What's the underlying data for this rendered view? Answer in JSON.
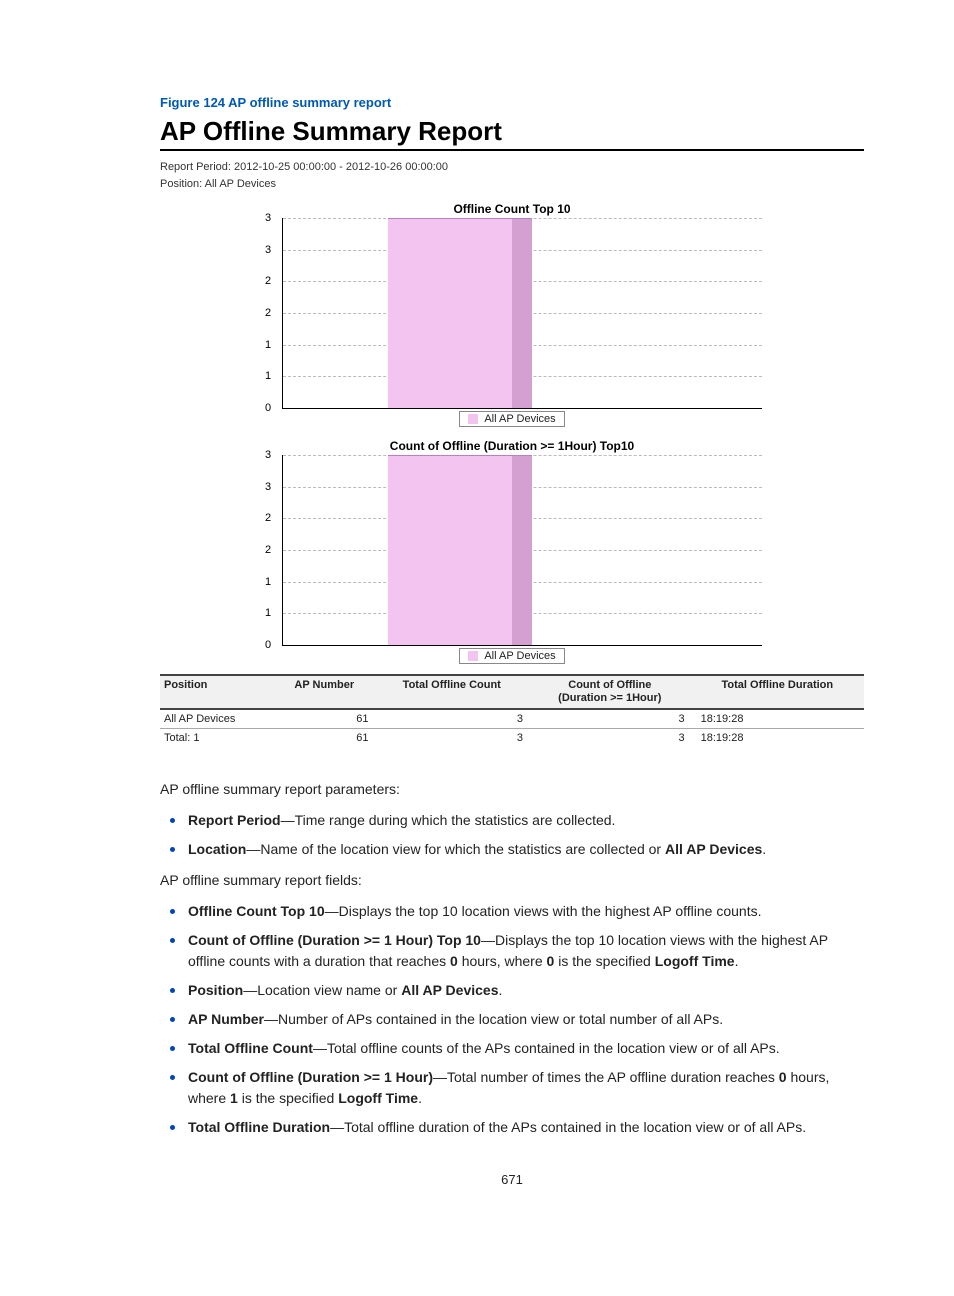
{
  "caption": "Figure 124 AP offline summary report",
  "report": {
    "title": "AP Offline Summary Report",
    "period_line": "Report Period: 2012-10-25 00:00:00  -  2012-10-26 00:00:00",
    "position_line": "Position: All AP Devices"
  },
  "chart_data": [
    {
      "id": "chart1",
      "type": "bar",
      "title": "Offline Count Top 10",
      "categories": [
        "All AP Devices"
      ],
      "values": [
        3
      ],
      "ylim": [
        0,
        3
      ],
      "yticks": [
        0,
        1,
        1,
        2,
        2,
        3,
        3
      ],
      "legend": "All AP Devices"
    },
    {
      "id": "chart2",
      "type": "bar",
      "title": "Count of Offline (Duration >= 1Hour) Top10",
      "categories": [
        "All AP Devices"
      ],
      "values": [
        3
      ],
      "ylim": [
        0,
        3
      ],
      "yticks": [
        0,
        1,
        1,
        2,
        2,
        3,
        3
      ],
      "legend": "All AP Devices"
    }
  ],
  "table": {
    "headers": {
      "position": "Position",
      "ap_number": "AP Number",
      "total_offline_count": "Total Offline Count",
      "count_offline_1h_line1": "Count of Offline",
      "count_offline_1h_line2": "(Duration >= 1Hour)",
      "total_offline_duration": "Total Offline Duration"
    },
    "rows": [
      {
        "position": "All AP Devices",
        "ap_number": "61",
        "total_offline_count": "3",
        "count_offline_1h": "3",
        "total_offline_duration": "18:19:28"
      }
    ],
    "total": {
      "position": "Total: 1",
      "ap_number": "61",
      "total_offline_count": "3",
      "count_offline_1h": "3",
      "total_offline_duration": "18:19:28"
    }
  },
  "text": {
    "params_intro": "AP offline summary report parameters:",
    "params": [
      {
        "term": "Report Period",
        "desc": "—Time range during which the statistics are collected."
      },
      {
        "term": "Location",
        "desc_before": "—Name of the location view for which the statistics are collected or ",
        "bold_tail": "All AP Devices",
        "desc_after": "."
      }
    ],
    "fields_intro": "AP offline summary report fields:",
    "fields": [
      {
        "term": "Offline Count Top 10",
        "desc": "—Displays the top 10 location views with the highest AP offline counts."
      },
      {
        "term": "Count of Offline (Duration >= 1 Hour) Top 10",
        "desc_before": "—Displays the top 10 location views with the highest AP offline counts with a duration that reaches ",
        "bold1": "0",
        "mid": " hours, where ",
        "bold2": "0",
        "mid2": " is the specified ",
        "bold3": "Logoff Time",
        "after": "."
      },
      {
        "term": "Position",
        "desc_before": "—Location view name or ",
        "bold_tail": "All AP Devices",
        "desc_after": "."
      },
      {
        "term": "AP Number",
        "desc": "—Number of APs contained in the location view or total number of all APs."
      },
      {
        "term": "Total Offline Count",
        "desc": "—Total offline counts of the APs contained in the location view or of all APs."
      },
      {
        "term": "Count of Offline (Duration >= 1 Hour)",
        "desc_before": "—Total number of times the AP offline duration reaches ",
        "bold1": "0",
        "mid": " hours, where ",
        "bold2": "1",
        "mid2": " is the specified ",
        "bold3": "Logoff Time",
        "after": "."
      },
      {
        "term": "Total Offline Duration",
        "desc": "—Total offline duration of the APs contained in the location view or of all APs."
      }
    ]
  },
  "page_number": "671"
}
